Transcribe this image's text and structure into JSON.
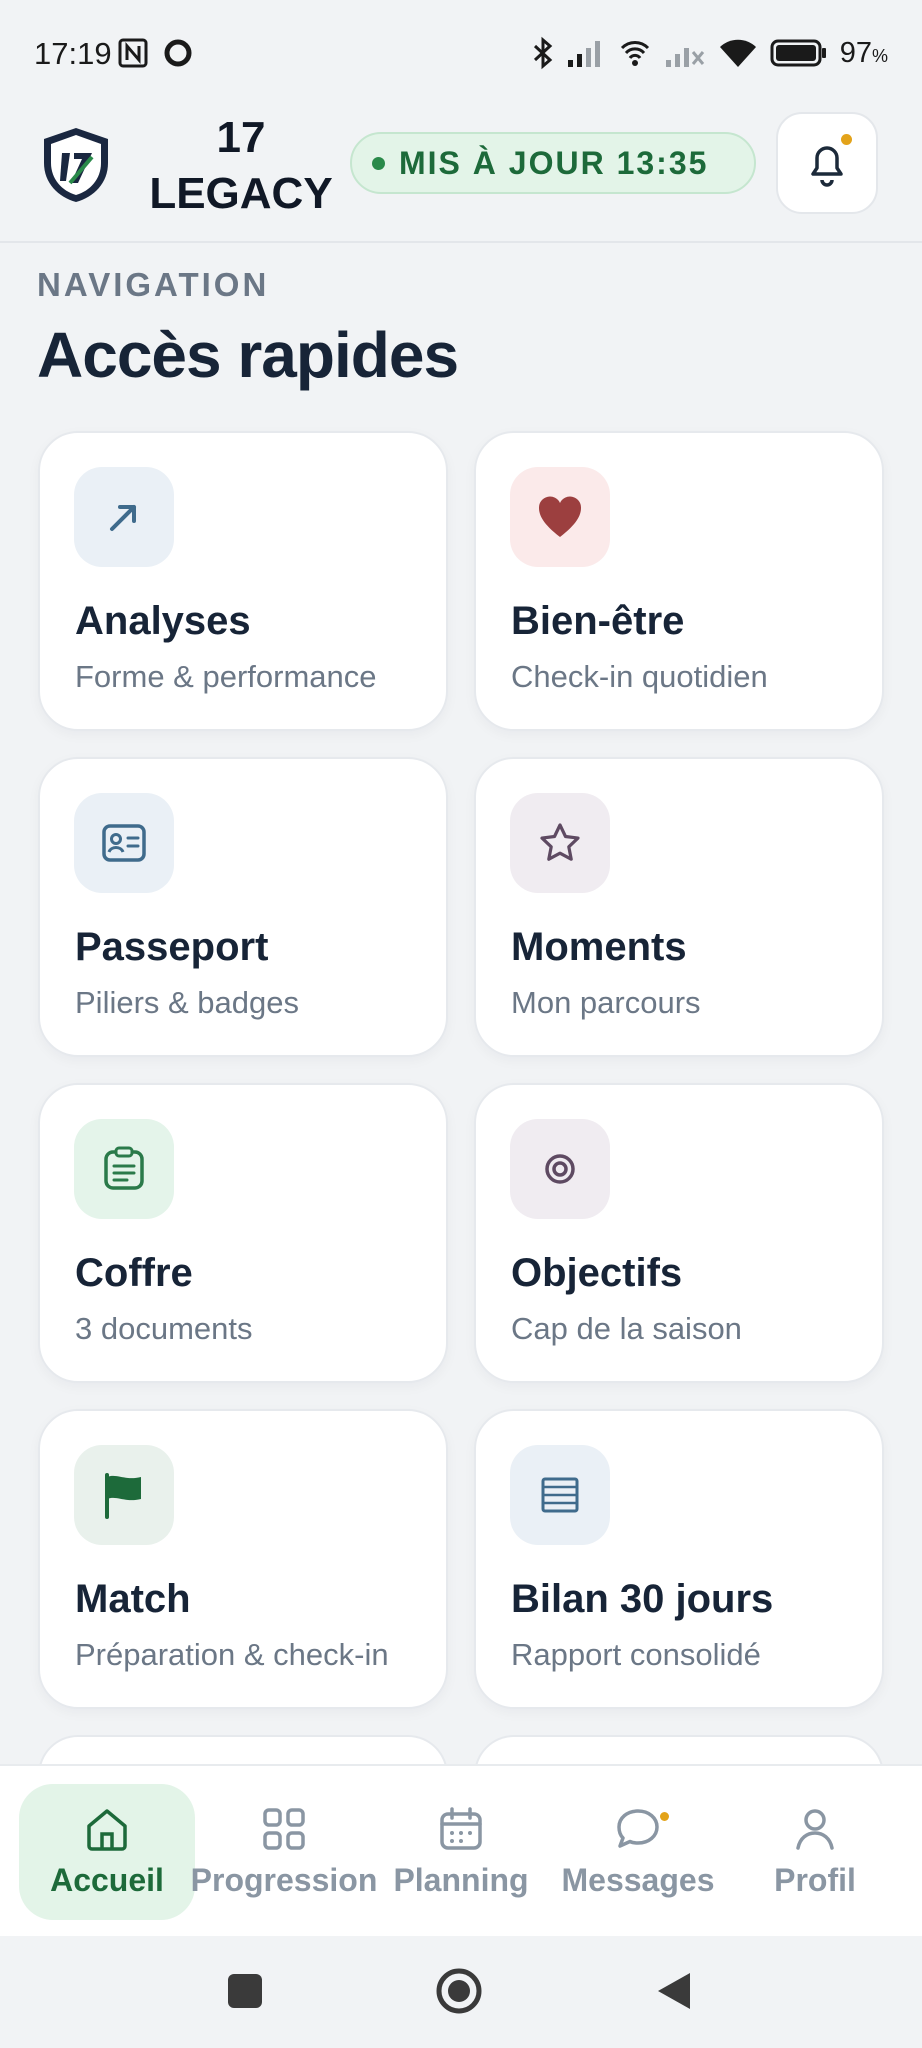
{
  "status_bar": {
    "time": "17:19",
    "battery": "97",
    "battery_unit": "%",
    "icons": [
      "nfc-icon",
      "record-icon",
      "bluetooth-icon",
      "signal-icon",
      "wifi-calling-icon",
      "signal-off-icon",
      "wifi-icon",
      "battery-icon"
    ]
  },
  "header": {
    "brand_line1": "17",
    "brand_line2": "LEGACY",
    "update_label": "MIS À JOUR 13:35",
    "notification_dot_color": "#e3a31a"
  },
  "section": {
    "kicker": "NAVIGATION",
    "title": "Accès rapides"
  },
  "cards": [
    {
      "title": "Analyses",
      "subtitle": "Forme & performance",
      "icon": "trend-arrow-icon",
      "icon_bg": "#eaf0f6",
      "icon_color": "#3f6b8c"
    },
    {
      "title": "Bien-être",
      "subtitle": "Check-in quotidien",
      "icon": "heart-icon",
      "icon_bg": "#fbeaea",
      "icon_color": "#9c3f3f"
    },
    {
      "title": "Passeport",
      "subtitle": "Piliers & badges",
      "icon": "id-card-icon",
      "icon_bg": "#eaf0f6",
      "icon_color": "#3f6b8c"
    },
    {
      "title": "Moments",
      "subtitle": "Mon parcours",
      "icon": "star-icon",
      "icon_bg": "#f0ecf1",
      "icon_color": "#5e4a62"
    },
    {
      "title": "Coffre",
      "subtitle": "3 documents",
      "icon": "clipboard-icon",
      "icon_bg": "#e4f4ea",
      "icon_color": "#2a7a4a"
    },
    {
      "title": "Objectifs",
      "subtitle": "Cap de la saison",
      "icon": "target-icon",
      "icon_bg": "#f0ecf1",
      "icon_color": "#5e4a62"
    },
    {
      "title": "Match",
      "subtitle": "Préparation & check-in",
      "icon": "flag-icon",
      "icon_bg": "#e9f1ec",
      "icon_color": "#1d6a3a"
    },
    {
      "title": "Bilan 30 jours",
      "subtitle": "Rapport consolidé",
      "icon": "report-icon",
      "icon_bg": "#eaf0f6",
      "icon_color": "#3f6b8c"
    }
  ],
  "bottom_nav": [
    {
      "label": "Accueil",
      "icon": "home-icon",
      "active": true
    },
    {
      "label": "Progression",
      "icon": "grid-icon",
      "active": false
    },
    {
      "label": "Planning",
      "icon": "calendar-icon",
      "active": false
    },
    {
      "label": "Messages",
      "icon": "chat-bubble-icon",
      "active": false
    },
    {
      "label": "Profil",
      "icon": "user-icon",
      "active": false
    }
  ],
  "colors": {
    "accent_green": "#1d6a3a",
    "accent_green_bg": "#e3f4e8",
    "background": "#f1f3f5",
    "text_dark": "#172437",
    "text_muted": "#6b7786"
  }
}
